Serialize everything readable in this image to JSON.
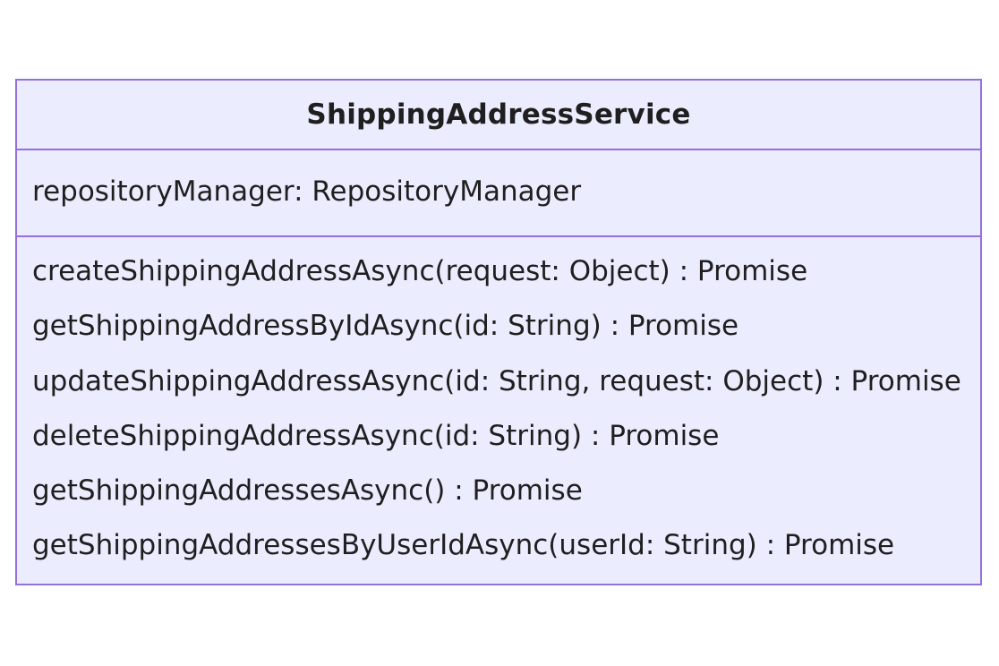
{
  "class_diagram": {
    "class_name": "ShippingAddressService",
    "attributes": [
      "repositoryManager: RepositoryManager"
    ],
    "methods": [
      "createShippingAddressAsync(request: Object) : Promise",
      "getShippingAddressByIdAsync(id: String) : Promise",
      "updateShippingAddressAsync(id: String, request: Object) : Promise",
      "deleteShippingAddressAsync(id: String) : Promise",
      "getShippingAddressesAsync() : Promise",
      "getShippingAddressesByUserIdAsync(userId: String) : Promise"
    ],
    "colors": {
      "fill": "#ececff",
      "border": "#9370db",
      "text": "#1f1f1f"
    }
  }
}
